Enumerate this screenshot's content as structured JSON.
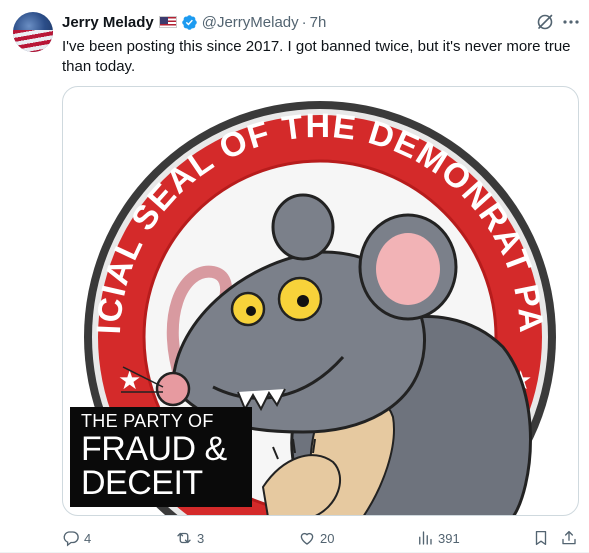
{
  "user": {
    "display_name": "Jerry Melady",
    "flag_icon": "us-flag-emoji",
    "verified_icon": "verified-badge-icon",
    "handle": "@JerryMelady",
    "separator": "·",
    "time": "7h"
  },
  "tweet": {
    "text": "I've been posting this since 2017. I got banned twice, but it's never more true than today."
  },
  "media": {
    "seal_text": "OFFICIAL SEAL OF THE DEMONRAT PARTY",
    "caption_line1": "THE PARTY OF",
    "caption_line2": "FRAUD &",
    "caption_line3": "DECEIT"
  },
  "actions": {
    "replies": "4",
    "reposts": "3",
    "likes": "20",
    "views": "391"
  },
  "colors": {
    "accent": "#1d9bf0",
    "muted": "#536471",
    "seal_red": "#d42a2a",
    "caption_bg": "#0a0a0a"
  }
}
